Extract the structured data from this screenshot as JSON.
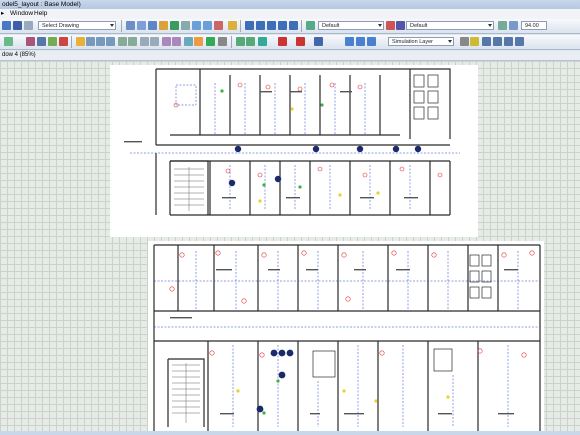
{
  "window": {
    "title": "odel5_layout : Base Model)"
  },
  "menu": {
    "items": [
      "Window",
      "Help"
    ],
    "prefix": "▸"
  },
  "toolbar1": {
    "drawing_select": "Select Drawing",
    "layer_default_1": "Default",
    "layer_default_2": "Default",
    "zoom_value": "94.00"
  },
  "toolbar2": {
    "layer_select": "Simulation Layer"
  },
  "canvas": {
    "title": "dow 4 (85%)"
  },
  "colors": {
    "accent": "#1f3fd0",
    "wall": "#2a2a2a",
    "marker": "#e23030"
  },
  "icons": [
    "save-icon",
    "undo-icon",
    "redo-icon",
    "zoom-icon",
    "lock-icon",
    "arrow-icon"
  ]
}
